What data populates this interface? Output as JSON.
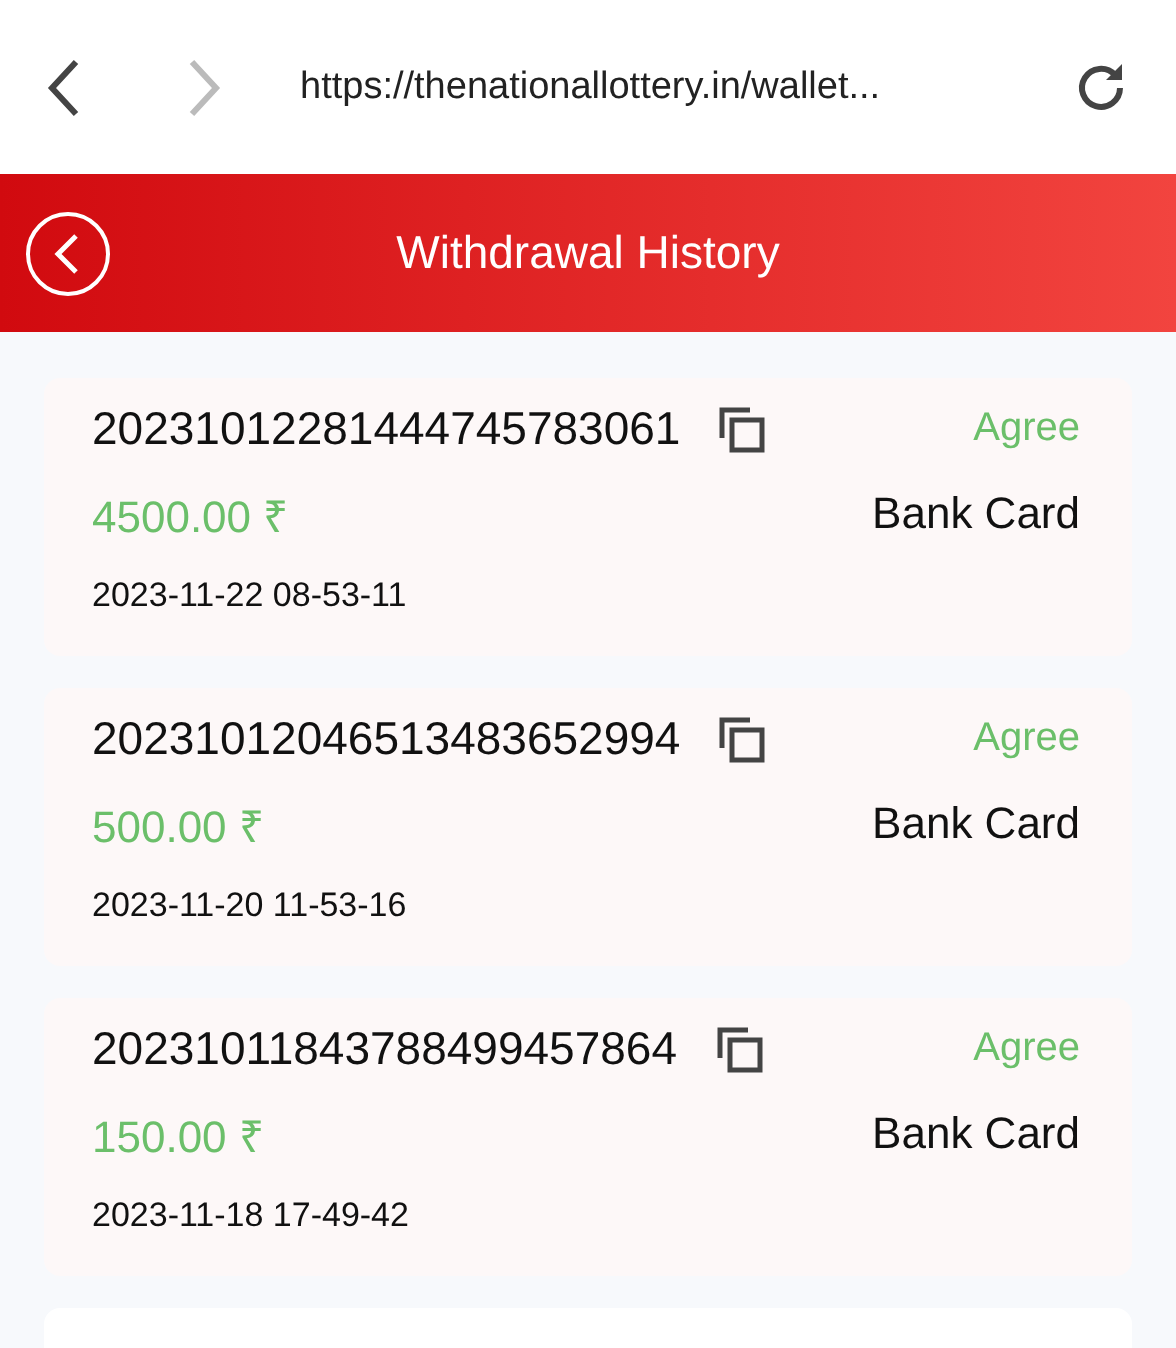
{
  "browser": {
    "back": {
      "disabled": false
    },
    "forward": {
      "disabled": true
    },
    "url": "https://thenationallottery.in/wallet..."
  },
  "header": {
    "title": "Withdrawal History"
  },
  "records": [
    {
      "order_number": "20231012281444745783061",
      "status": "Agree",
      "amount": "4500.00 ₹",
      "method": "Bank Card",
      "time": "2023-11-22 08-53-11"
    },
    {
      "order_number": "20231012046513483652994",
      "status": "Agree",
      "amount": "500.00 ₹",
      "method": "Bank Card",
      "time": "2023-11-20 11-53-16"
    },
    {
      "order_number": "20231011843788499457864",
      "status": "Agree",
      "amount": "150.00 ₹",
      "method": "Bank Card",
      "time": "2023-11-18 17-49-42"
    }
  ]
}
